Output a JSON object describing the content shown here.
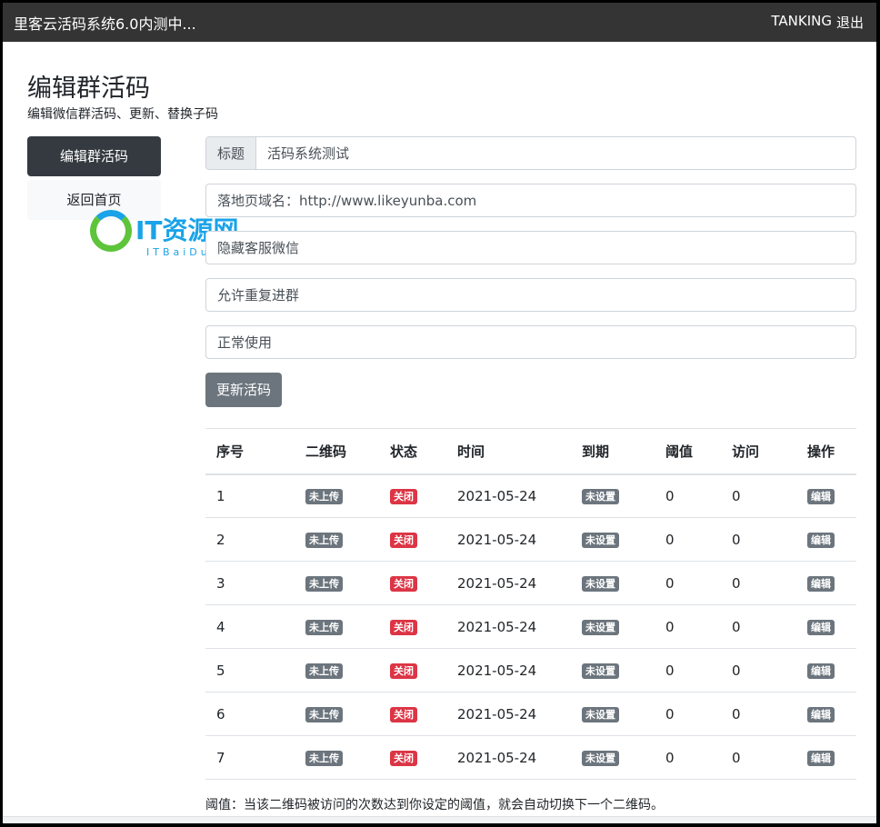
{
  "navbar": {
    "brand": "里客云活码系统6.0内测中...",
    "user": "TANKING",
    "logout": "退出"
  },
  "header": {
    "title": "编辑群活码",
    "subtitle": "编辑微信群活码、更新、替换子码"
  },
  "sidebar": {
    "items": [
      {
        "label": "编辑群活码",
        "active": true
      },
      {
        "label": "返回首页",
        "active": false
      }
    ]
  },
  "form": {
    "title_prefix": "标题",
    "title_value": "活码系统测试",
    "domain_value": "落地页域名：http://www.likeyunba.com",
    "kefu_value": "隐藏客服微信",
    "repeat_value": "允许重复进群",
    "status_value": "正常使用",
    "submit_label": "更新活码"
  },
  "table": {
    "headers": [
      "序号",
      "二维码",
      "状态",
      "时间",
      "到期",
      "阈值",
      "访问",
      "操作"
    ],
    "rows": [
      {
        "id": "1",
        "qr": "未上传",
        "status": "关闭",
        "time": "2021-05-24",
        "expire": "未设置",
        "threshold": "0",
        "visits": "0",
        "action": "编辑"
      },
      {
        "id": "2",
        "qr": "未上传",
        "status": "关闭",
        "time": "2021-05-24",
        "expire": "未设置",
        "threshold": "0",
        "visits": "0",
        "action": "编辑"
      },
      {
        "id": "3",
        "qr": "未上传",
        "status": "关闭",
        "time": "2021-05-24",
        "expire": "未设置",
        "threshold": "0",
        "visits": "0",
        "action": "编辑"
      },
      {
        "id": "4",
        "qr": "未上传",
        "status": "关闭",
        "time": "2021-05-24",
        "expire": "未设置",
        "threshold": "0",
        "visits": "0",
        "action": "编辑"
      },
      {
        "id": "5",
        "qr": "未上传",
        "status": "关闭",
        "time": "2021-05-24",
        "expire": "未设置",
        "threshold": "0",
        "visits": "0",
        "action": "编辑"
      },
      {
        "id": "6",
        "qr": "未上传",
        "status": "关闭",
        "time": "2021-05-24",
        "expire": "未设置",
        "threshold": "0",
        "visits": "0",
        "action": "编辑"
      },
      {
        "id": "7",
        "qr": "未上传",
        "status": "关闭",
        "time": "2021-05-24",
        "expire": "未设置",
        "threshold": "0",
        "visits": "0",
        "action": "编辑"
      }
    ]
  },
  "note": "阈值：当该二维码被访问的次数达到你设定的阈值，就会自动切换下一个二维码。",
  "watermark": {
    "main": "IT资源网",
    "sub": "ITBaiDu.com"
  }
}
